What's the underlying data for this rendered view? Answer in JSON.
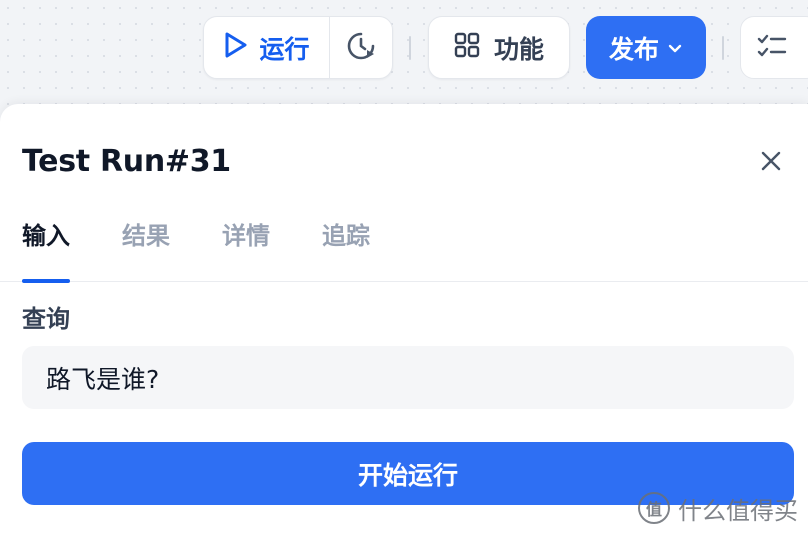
{
  "toolbar": {
    "run_label": "运行",
    "function_label": "功能",
    "publish_label": "发布",
    "accent_color": "#2e6ff3"
  },
  "panel": {
    "title": "Test Run#31",
    "tabs": [
      {
        "label": "输入",
        "active": true
      },
      {
        "label": "结果",
        "active": false
      },
      {
        "label": "详情",
        "active": false
      },
      {
        "label": "追踪",
        "active": false
      }
    ],
    "query": {
      "label": "查询",
      "value": "路飞是谁?"
    },
    "start_label": "开始运行"
  },
  "watermark": {
    "logo_text": "值",
    "text": "什么值得买"
  },
  "icons": [
    "play-icon",
    "history-icon",
    "grid-icon",
    "chevron-down-icon",
    "checklist-icon",
    "close-icon"
  ]
}
